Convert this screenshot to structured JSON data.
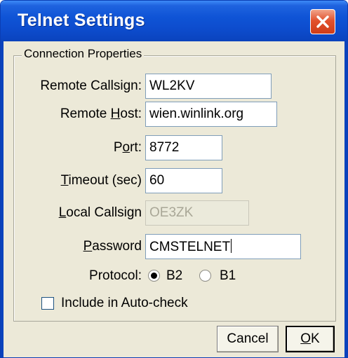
{
  "window": {
    "title": "Telnet Settings"
  },
  "group": {
    "title": "Connection Properties"
  },
  "fields": {
    "remote_callsign": {
      "label": "Remote Callsign:",
      "value": "WL2KV"
    },
    "remote_host": {
      "label_pre": "Remote ",
      "label_accel": "H",
      "label_post": "ost:",
      "value": "wien.winlink.org"
    },
    "port": {
      "label_pre": "P",
      "label_accel": "o",
      "label_post": "rt:",
      "value": "8772"
    },
    "timeout": {
      "label_pre": "",
      "label_accel": "T",
      "label_post": "imeout (sec)",
      "value": "60"
    },
    "local_callsign": {
      "label_pre": "",
      "label_accel": "L",
      "label_post": "ocal Callsign",
      "value": "OE3ZK"
    },
    "password": {
      "label_pre": "",
      "label_accel": "P",
      "label_post": "assword",
      "value": "CMSTELNET"
    }
  },
  "protocol": {
    "label": "Protocol:",
    "options": [
      "B2",
      "B1"
    ],
    "selected": "B2"
  },
  "autocheck": {
    "label": "Include in Auto-check",
    "checked": false
  },
  "buttons": {
    "cancel": "Cancel",
    "ok_accel": "O",
    "ok_rest": "K"
  }
}
